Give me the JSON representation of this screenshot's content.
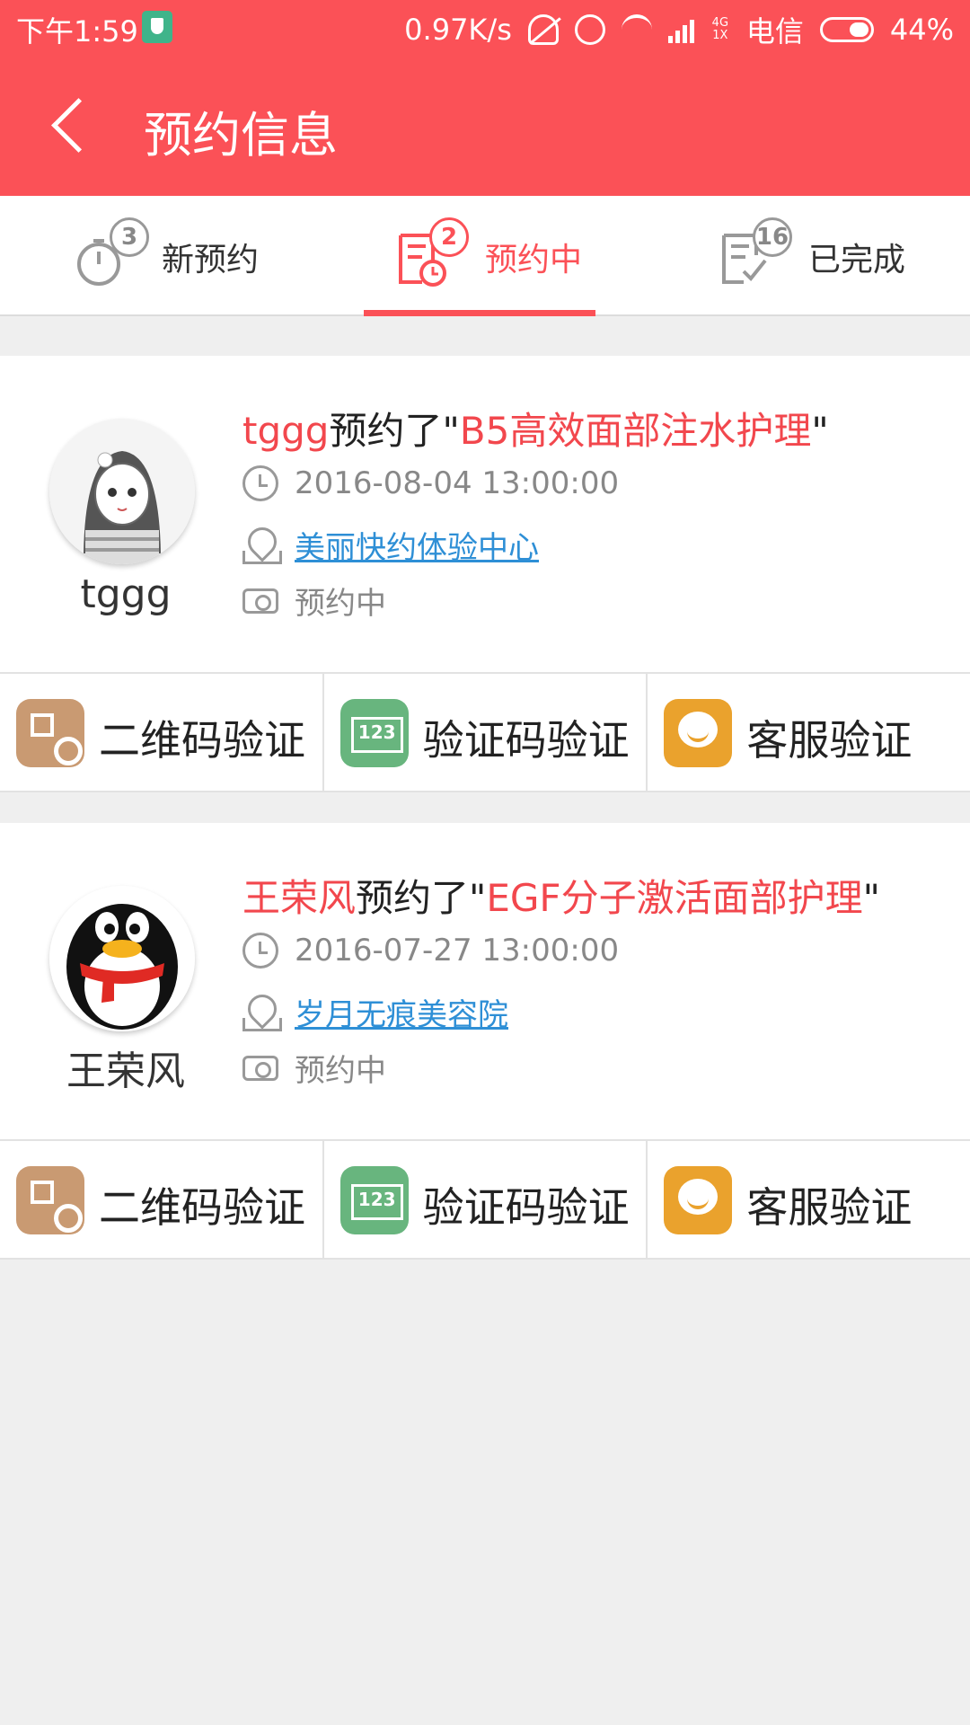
{
  "status_bar": {
    "time": "下午1:59",
    "speed": "0.97K/s",
    "network": "4G 1X",
    "carrier": "电信",
    "battery": "44%",
    "battery_level": 0.44
  },
  "header": {
    "title": "预约信息"
  },
  "tabs": [
    {
      "label": "新预约",
      "count": "3",
      "icon": "stopwatch-icon"
    },
    {
      "label": "预约中",
      "count": "2",
      "icon": "list-clock-icon"
    },
    {
      "label": "已完成",
      "count": "16",
      "icon": "list-check-icon"
    }
  ],
  "active_tab": 1,
  "appointments": [
    {
      "user": "tggg",
      "action_text": "预约了\"",
      "service": "B5高效面部注水护理",
      "close_quote": "\"",
      "datetime": "2016-08-04 13:00:00",
      "location": "美丽快约体验中心",
      "status": "预约中",
      "avatar": "anime-girl-avatar"
    },
    {
      "user": "王荣风",
      "action_text": "预约了\"",
      "service": "EGF分子激活面部护理",
      "close_quote": "\"",
      "datetime": "2016-07-27 13:00:00",
      "location": "岁月无痕美容院",
      "status": "预约中",
      "avatar": "penguin-avatar"
    }
  ],
  "verify_actions": [
    {
      "label": "二维码验证",
      "icon": "qr-code-icon",
      "color": "#c99a72"
    },
    {
      "label": "验证码验证",
      "icon": "code-123-icon",
      "color": "#68b57e"
    },
    {
      "label": "客服验证",
      "icon": "customer-service-icon",
      "color": "#eaa22d"
    }
  ],
  "colors": {
    "brand": "#fb5157",
    "link": "#2e8fd6"
  }
}
